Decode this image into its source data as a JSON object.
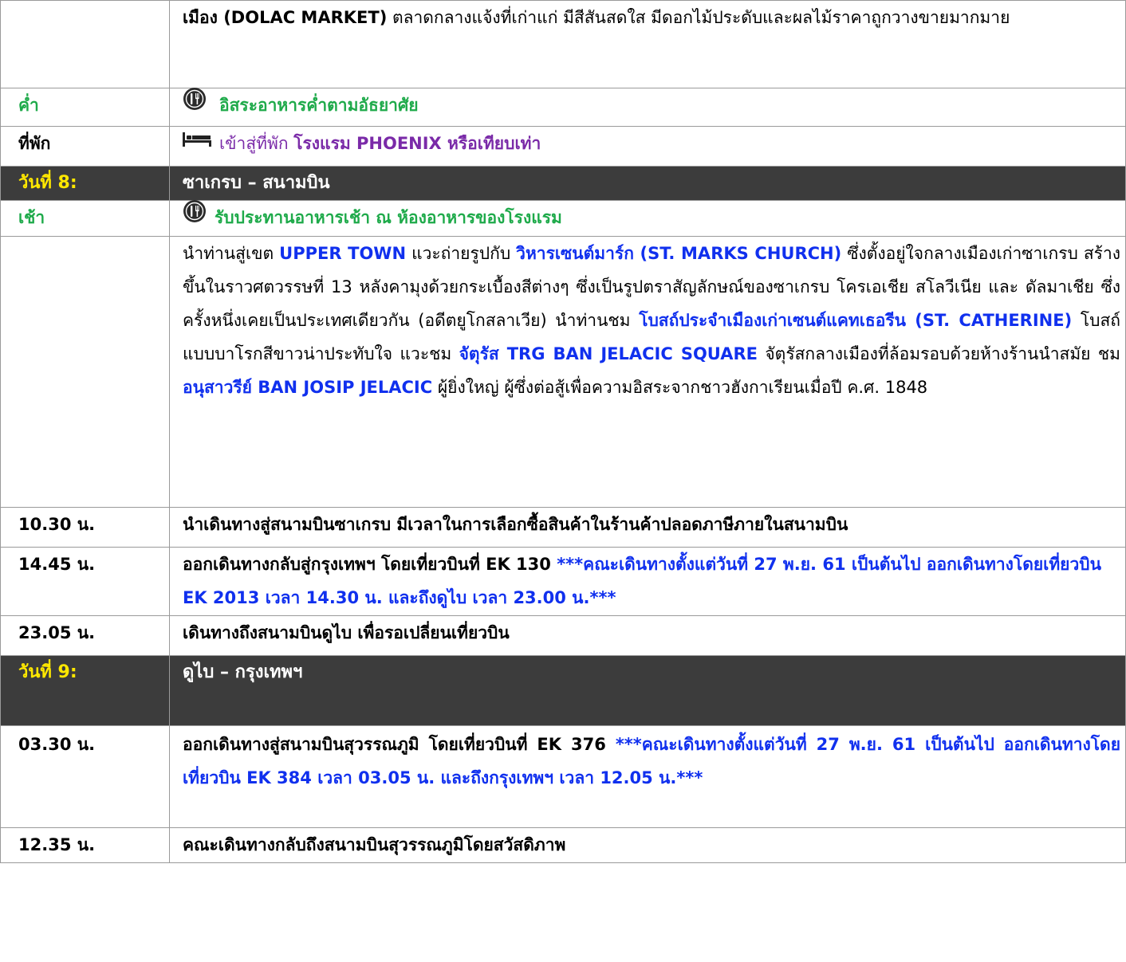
{
  "colors": {
    "meal_green": "#1eaa4a",
    "hotel_purple": "#7a2aa8",
    "highlight_blue": "#1030ee",
    "day_bar_bg": "#3c3c3c",
    "day_label_yellow": "#ffe800"
  },
  "icons": {
    "meal": "meal-icon",
    "hotel": "bed-icon"
  },
  "r0": {
    "t1": "เมือง (DOLAC MARKET)",
    "t2": " ตลาดกลางแจ้งที่เก่าแก่ มีสีสันสดใส มีดอกไม้ประดับและผลไม้ราคาถูกวางขายมากมาย"
  },
  "r1": {
    "label": "ค่ำ",
    "text": "อิสระอาหารค่ำตามอัธยาศัย"
  },
  "r2": {
    "label": "ที่พัก",
    "t1": "เข้าสู่ที่พัก ",
    "t2": "โรงแรม PHOENIX หรือเทียบเท่า"
  },
  "day8": {
    "label": "วันที่ 8:",
    "title": "ซาเกรบ – สนามบิน"
  },
  "r4": {
    "label": "เช้า",
    "text": "รับประทานอาหารเช้า ณ ห้องอาหารของโรงแรม"
  },
  "r5": {
    "t1": "นำท่านสู่เขต ",
    "t2": "UPPER TOWN",
    "t3": " แวะถ่ายรูปกับ ",
    "t4": "วิหารเซนต์มาร์ก (ST. MARKS CHURCH)",
    "t5": " ซึ่งตั้งอยู่ใจกลางเมืองเก่าซาเกรบ สร้างขึ้นในราวศตวรรษที่ 13 หลังคามุงด้วยกระเบื้องสีต่างๆ ซึ่งเป็นรูปตราสัญลักษณ์ของซาเกรบ โครเอเชีย สโลวีเนีย และ ดัลมาเชีย ซึ่งครั้งหนึ่งเคยเป็นประเทศเดียวกัน (อดีตยูโกสลาเวีย) นำท่านชม ",
    "t6": "โบสถ์ประจำเมืองเก่าเซนต์แคทเธอรีน (ST. CATHERINE)",
    "t7": " โบสถ์แบบบาโรกสีขาวน่าประทับใจ แวะชม ",
    "t8": "จัตุรัส TRG BAN JELACIC SQUARE",
    "t9": " จัตุรัสกลางเมืองที่ล้อมรอบด้วยห้างร้านนำสมัย ชม ",
    "t10": "อนุสาวรีย์ BAN JOSIP JELACIC",
    "t11": " ผู้ยิ่งใหญ่ ผู้ซึ่งต่อสู้เพื่อความอิสระจากชาวฮังกาเรียนเมื่อปี ค.ศ. 1848"
  },
  "r6": {
    "time": "10.30 น.",
    "text": "นำเดินทางสู่สนามบินซาเกรบ มีเวลาในการเลือกซื้อสินค้าในร้านค้าปลอดภาษีภายในสนามบิน"
  },
  "r7": {
    "time": "14.45 น.",
    "t1": "ออกเดินทางกลับสู่กรุงเทพฯ โดยเที่ยวบินที่ EK 130 ",
    "t2": "***คณะเดินทางตั้งแต่วันที่ 27 พ.ย. 61 เป็นต้นไป ออกเดินทางโดยเที่ยวบิน EK 2013 เวลา 14.30 น. และถึงดูไบ เวลา 23.00 น.***"
  },
  "r8": {
    "time": "23.05 น.",
    "text": "เดินทางถึงสนามบินดูไบ เพื่อรอเปลี่ยนเที่ยวบิน"
  },
  "day9": {
    "label": "วันที่ 9:",
    "title": "ดูไบ – กรุงเทพฯ"
  },
  "r10": {
    "time": "03.30 น.",
    "t1": "ออกเดินทางสู่สนามบินสุวรรณภูมิ โดยเที่ยวบินที่ EK 376 ",
    "t2": "***คณะเดินทางตั้งแต่วันที่ 27 พ.ย. 61 เป็นต้นไป ออกเดินทางโดยเที่ยวบิน EK 384 เวลา 03.05 น. และถึงกรุงเทพฯ เวลา 12.05 น.***"
  },
  "r11": {
    "time": "12.35 น.",
    "text": "คณะเดินทางกลับถึงสนามบินสุวรรณภูมิโดยสวัสดิภาพ"
  }
}
